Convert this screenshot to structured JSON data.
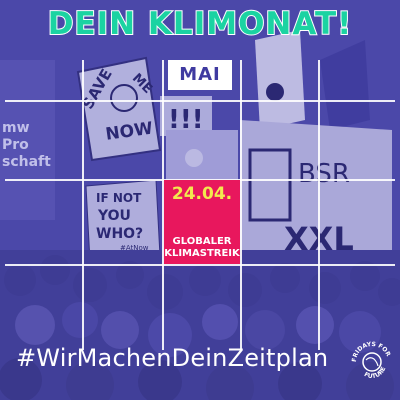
{
  "header": {
    "title": "DEIN KLIMONAT!"
  },
  "calendar": {
    "month": "MAI",
    "event": {
      "date": "24.04.",
      "line1": "GLOBALER",
      "line2": "KLIMASTREIK"
    }
  },
  "footer": {
    "hashtag": "#WirMachenDeinZeitplan"
  },
  "logo": {
    "top": "FRIDAYS FOR",
    "bottom": "FUTURE"
  },
  "background_signs": {
    "sign1": [
      "SAVE",
      "ME",
      "NOW"
    ],
    "sign2": [
      "IF NOT",
      "YOU",
      "WHO?",
      "#AtNow"
    ],
    "sign3": [
      "BSR",
      "XXL"
    ],
    "sign4": [
      "mw",
      "Pro",
      "schaft"
    ]
  },
  "colors": {
    "accent_green": "#1bd3a2",
    "event_pink": "#e8175d",
    "event_yellow": "#f2e94e",
    "overlay_purple": "#4a47a6"
  }
}
